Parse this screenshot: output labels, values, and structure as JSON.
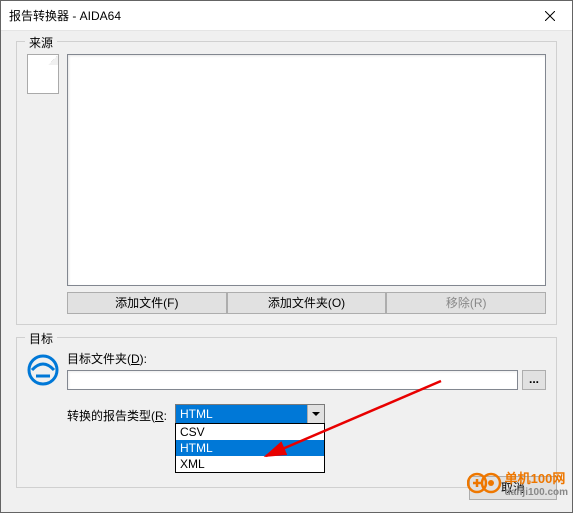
{
  "window": {
    "title": "报告转换器 - AIDA64"
  },
  "source": {
    "label": "来源",
    "add_file": "添加文件(F)",
    "add_folder": "添加文件夹(O)",
    "remove": "移除(R)"
  },
  "dest": {
    "label": "目标",
    "folder_label_pre": "目标文件夹(",
    "folder_label_ul": "D",
    "folder_label_post": "):",
    "path": "",
    "browse": "...",
    "type_label_pre": "转换的报告类型(",
    "type_label_ul": "R",
    "type_label_post": ":",
    "type_selected": "HTML",
    "options": [
      "CSV",
      "HTML",
      "XML"
    ]
  },
  "buttons": {
    "cancel": "取消"
  },
  "watermark": {
    "brand": "单机100网",
    "url": "danji100.com"
  }
}
